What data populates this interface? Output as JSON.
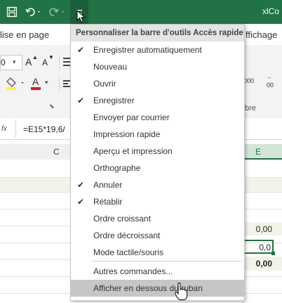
{
  "title_text": "xlCo",
  "tab_partial_left": "lise en page",
  "tab_partial_right": "ffichage",
  "font_size_value": "0",
  "grow_font": "A",
  "shrink_font": "A",
  "number_decimal_left": "000",
  "number_decimal_right": "00",
  "group_label_partial": "bre",
  "formula_fx": "fx",
  "formula_value": "=E15*19,6/",
  "col_c": "C",
  "col_e": "E",
  "cells": {
    "e1": "0,00",
    "e2": "0,0",
    "e3": "0,00"
  },
  "menu": {
    "header": "Personnaliser la barre d'outils Accès rapide",
    "items": [
      {
        "label": "Enregistrer automatiquement",
        "checked": true
      },
      {
        "label": "Nouveau",
        "checked": false
      },
      {
        "label": "Ouvrir",
        "checked": false
      },
      {
        "label": "Enregistrer",
        "checked": true
      },
      {
        "label": "Envoyer par courrier",
        "checked": false
      },
      {
        "label": "Impression rapide",
        "checked": false
      },
      {
        "label": "Aperçu et impression",
        "checked": false
      },
      {
        "label": "Orthographe",
        "checked": false
      },
      {
        "label": "Annuler",
        "checked": true
      },
      {
        "label": "Rétablir",
        "checked": true
      },
      {
        "label": "Ordre croissant",
        "checked": false
      },
      {
        "label": "Ordre décroissant",
        "checked": false
      },
      {
        "label": "Mode tactile/souris",
        "checked": false
      }
    ],
    "more_commands": "Autres commandes...",
    "show_below": "Afficher en dessous du ruban"
  },
  "colors": {
    "excel_green": "#217346",
    "highlight": "#c6c6c6",
    "selected_green": "#217346"
  }
}
